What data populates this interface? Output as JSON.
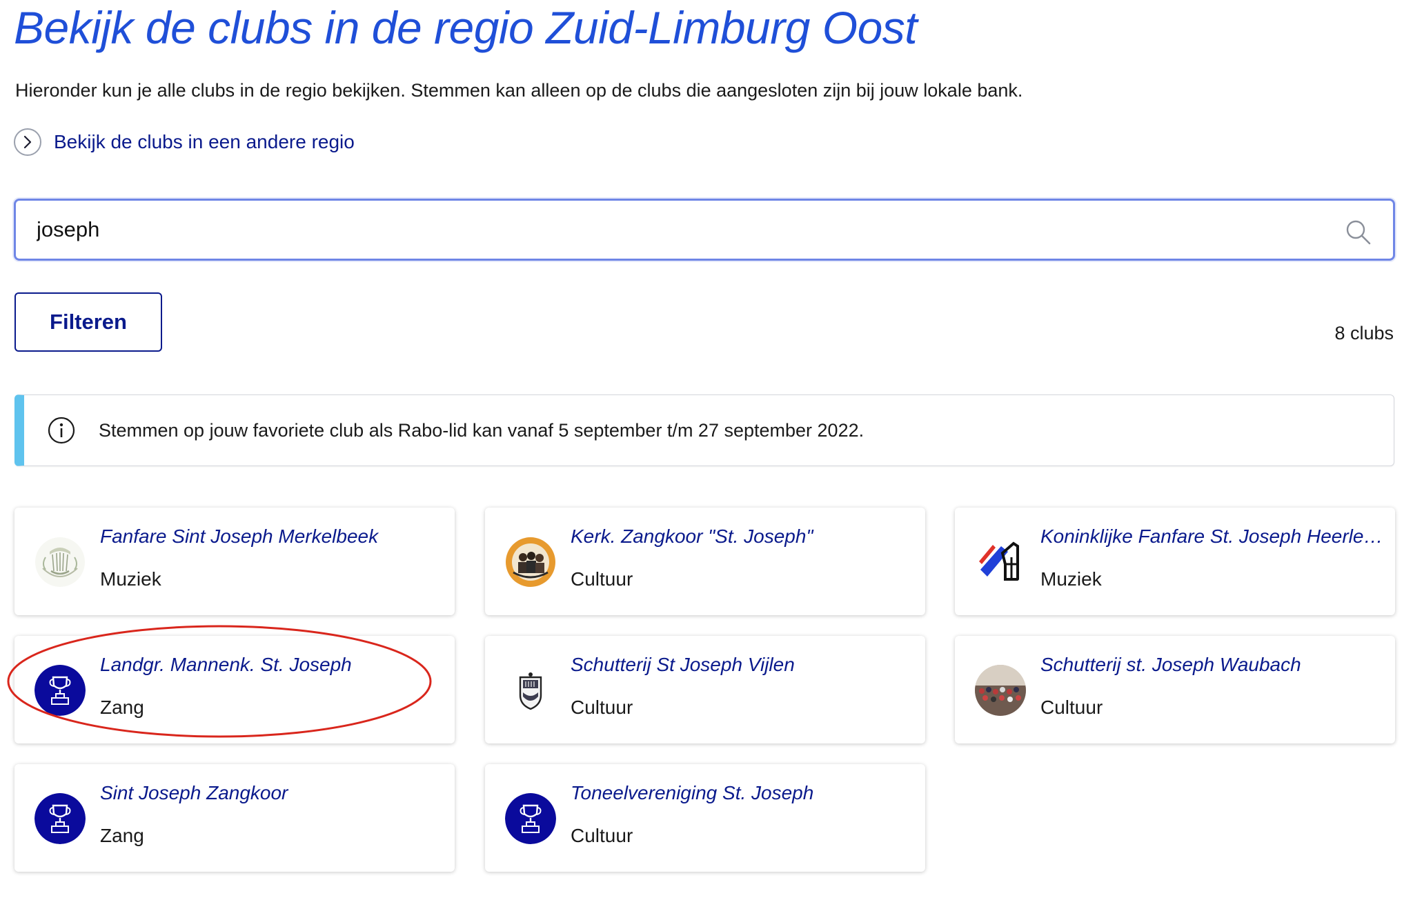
{
  "page": {
    "title": "Bekijk de clubs in de regio Zuid-Limburg Oost",
    "intro": "Hieronder kun je alle clubs in de regio bekijken. Stemmen kan alleen op de clubs die aangesloten zijn bij jouw lokale bank.",
    "region_link": "Bekijk de clubs in een andere regio"
  },
  "search": {
    "value": "joseph",
    "placeholder": ""
  },
  "toolbar": {
    "filter_label": "Filteren",
    "count_label": "8 clubs"
  },
  "info": {
    "text": "Stemmen op jouw favoriete club als Rabo-lid kan vanaf 5 september t/m 27 september 2022."
  },
  "colors": {
    "title": "#1f4fd8",
    "link": "#0a1a8c",
    "info_accent": "#5fc3ee",
    "default_logo_bg": "#0a0a9c",
    "highlight": "#d9261c"
  },
  "clubs": [
    {
      "name": "Fanfare Sint Joseph Merkelbeek",
      "category": "Muziek",
      "logo": "lyre-emblem-icon"
    },
    {
      "name": "Kerk. Zangkoor \"St. Joseph\"",
      "category": "Cultuur",
      "logo": "choir-photo-icon"
    },
    {
      "name": "Koninklijke Fanfare St. Joseph Heerlerheide",
      "category": "Muziek",
      "logo": "fanfare-logo-icon"
    },
    {
      "name": "Landgr. Mannenk. St. Joseph",
      "category": "Zang",
      "logo": "trophy-icon"
    },
    {
      "name": "Schutterij St Joseph Vijlen",
      "category": "Cultuur",
      "logo": "shield-crest-icon"
    },
    {
      "name": "Schutterij st. Joseph Waubach",
      "category": "Cultuur",
      "logo": "group-photo-icon"
    },
    {
      "name": "Sint Joseph Zangkoor",
      "category": "Zang",
      "logo": "trophy-icon"
    },
    {
      "name": "Toneelvereniging St. Joseph",
      "category": "Cultuur",
      "logo": "trophy-icon"
    }
  ]
}
